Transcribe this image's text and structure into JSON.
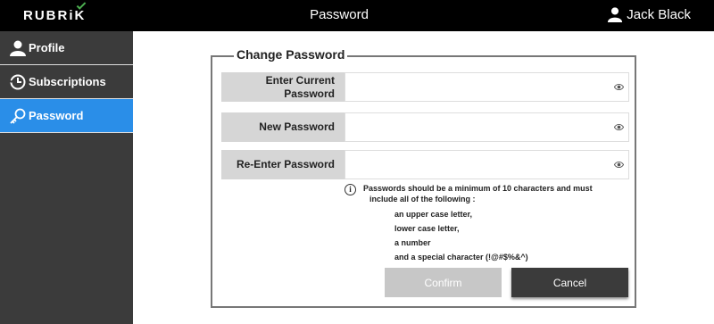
{
  "header": {
    "brand": "RUBRiK",
    "title": "Password",
    "user_name": "Jack Black"
  },
  "sidebar": {
    "items": [
      {
        "label": "Profile",
        "icon": "profile-icon",
        "active": false
      },
      {
        "label": "Subscriptions",
        "icon": "subscriptions-icon",
        "active": false
      },
      {
        "label": "Password",
        "icon": "key-icon",
        "active": true
      }
    ]
  },
  "form": {
    "legend": "Change Password",
    "fields": [
      {
        "label_lines": [
          "Enter Current",
          "Password"
        ],
        "value": ""
      },
      {
        "label": "New Password",
        "value": ""
      },
      {
        "label": "Re-Enter Password",
        "value": ""
      }
    ],
    "info": {
      "lines": [
        "Passwords should be a minimum of 10 characters and must",
        "include all of the following :",
        "an upper case letter,",
        "lower case letter,",
        "a number",
        "and a special character (!@#$%&^)"
      ]
    },
    "confirm_label": "Confirm",
    "cancel_label": "Cancel"
  },
  "colors": {
    "accent": "#2a8ee8",
    "sidebar_bg": "#3b3b3b",
    "topbar_bg": "#000000",
    "brand_check": "#4caf50"
  }
}
